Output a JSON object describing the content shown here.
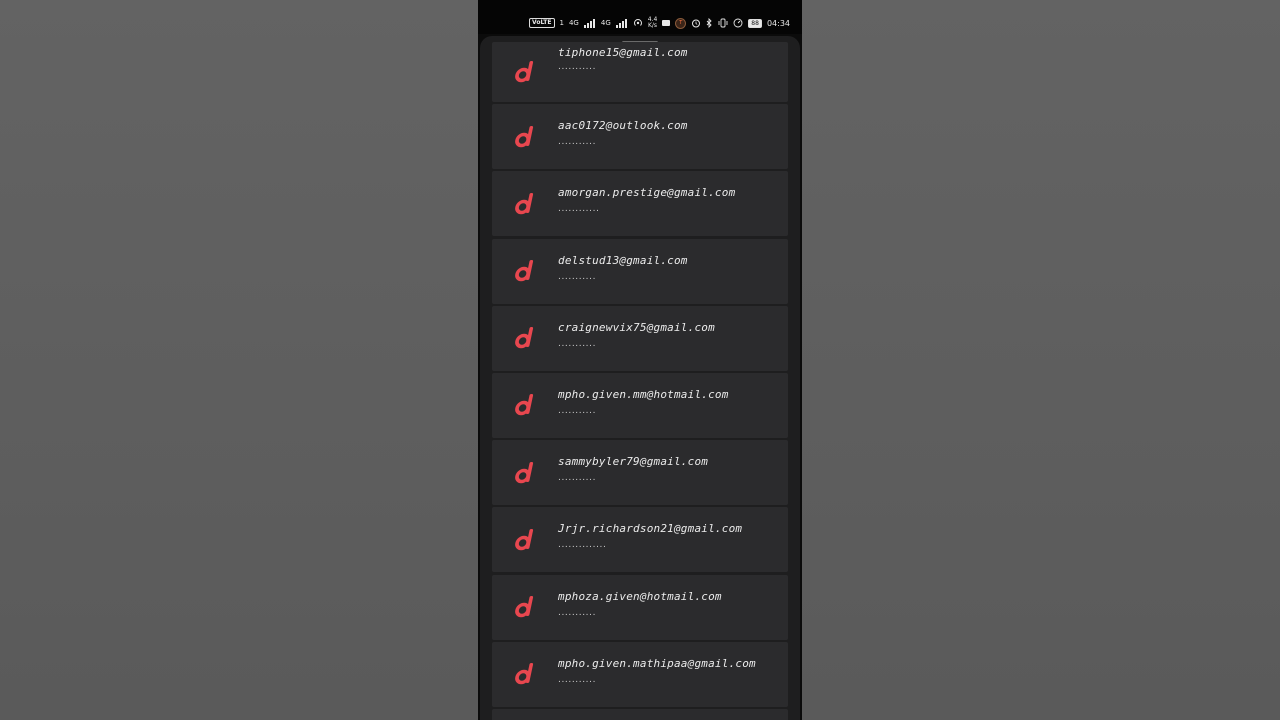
{
  "status_bar": {
    "volte_label": "VoLTE",
    "sim_1": "1",
    "network_1": "4G",
    "network_2": "4G",
    "speed_value": "4.4",
    "speed_unit": "K/s",
    "battery_level": "88",
    "time": "04:34"
  },
  "accounts": [
    {
      "email": "tiphone15@gmail.com",
      "password_mask": "..........."
    },
    {
      "email": "aac0172@outlook.com",
      "password_mask": "..........."
    },
    {
      "email": "amorgan.prestige@gmail.com",
      "password_mask": "............"
    },
    {
      "email": "delstud13@gmail.com",
      "password_mask": "..........."
    },
    {
      "email": "craignewvix75@gmail.com",
      "password_mask": "..........."
    },
    {
      "email": "mpho.given.mm@hotmail.com",
      "password_mask": "..........."
    },
    {
      "email": "sammybyler79@gmail.com",
      "password_mask": "..........."
    },
    {
      "email": "Jrjr.richardson21@gmail.com",
      "password_mask": ".............."
    },
    {
      "email": "mphoza.given@hotmail.com",
      "password_mask": "..........."
    },
    {
      "email": "mpho.given.mathipaa@gmail.com",
      "password_mask": "..........."
    }
  ],
  "theme": {
    "logo_color": "#e8474f",
    "card_color": "#2b2b2d",
    "sheet_color": "#1e1e1f"
  },
  "icons": {
    "account_logo": "d-logo-icon"
  }
}
